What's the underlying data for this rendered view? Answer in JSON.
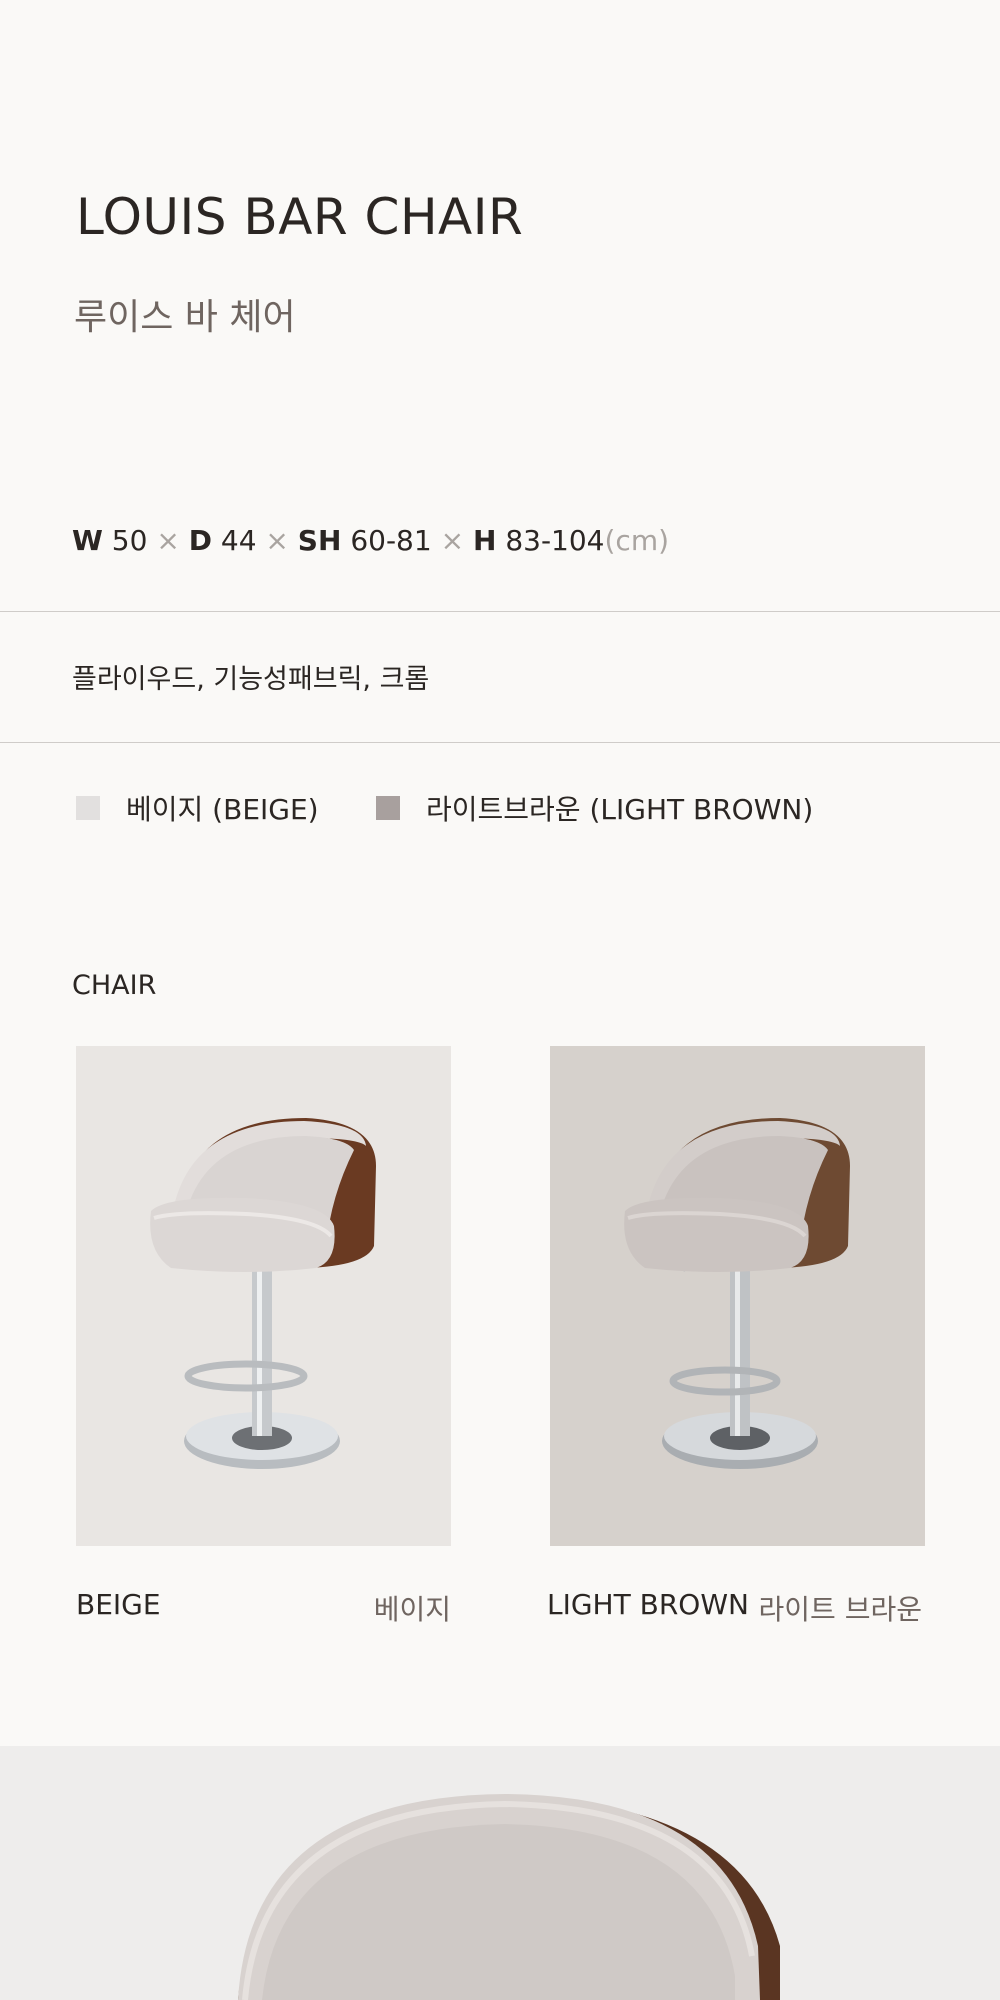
{
  "product": {
    "title": "LOUIS BAR CHAIR",
    "subtitle": "루이스 바 체어"
  },
  "dimensions": {
    "w_label": "W",
    "w_value": "50",
    "d_label": "D",
    "d_value": "44",
    "sh_label": "SH",
    "sh_value": "60-81",
    "h_label": "H",
    "h_value": "83-104",
    "separator": "×",
    "unit": "(cm)"
  },
  "materials": "플라이우드, 기능성패브릭, 크롬",
  "colors": [
    {
      "label": "베이지 (BEIGE)",
      "swatch": "#e2e0df"
    },
    {
      "label": "라이트브라운 (LIGHT BROWN)",
      "swatch": "#a8a09e"
    }
  ],
  "section": {
    "label": "CHAIR"
  },
  "cards": [
    {
      "name_en": "BEIGE",
      "name_ko": "베이지",
      "bg_color": "#e9e6e3",
      "icon": "beige-bar-chair-photo"
    },
    {
      "name_en": "LIGHT BROWN",
      "name_ko": "라이트 브라운",
      "bg_color": "#d6d1cc",
      "icon": "light-brown-bar-chair-photo"
    }
  ],
  "closeup": {
    "bg_color": "#eeedec",
    "icon": "chair-backrest-closeup-photo"
  }
}
